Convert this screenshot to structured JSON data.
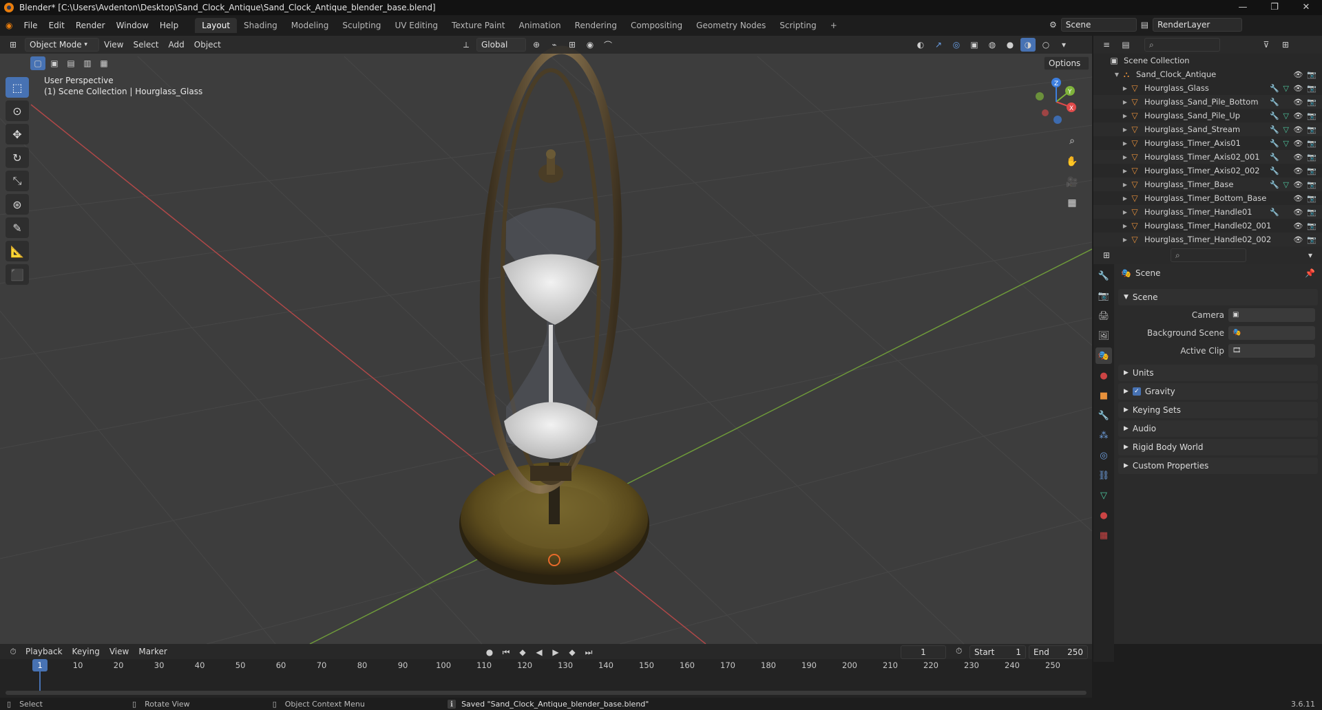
{
  "window": {
    "title": "Blender* [C:\\Users\\Avdenton\\Desktop\\Sand_Clock_Antique\\Sand_Clock_Antique_blender_base.blend]",
    "controls": [
      "—",
      "❐",
      "✕"
    ]
  },
  "menubar": {
    "menus": [
      "File",
      "Edit",
      "Render",
      "Window",
      "Help"
    ],
    "workspaces": [
      "Layout",
      "Shading",
      "Modeling",
      "Sculpting",
      "UV Editing",
      "Texture Paint",
      "Animation",
      "Rendering",
      "Compositing",
      "Geometry Nodes",
      "Scripting"
    ],
    "active_workspace": "Layout",
    "add_tab": "+",
    "scene_label": "Scene",
    "renderlayer_label": "RenderLayer"
  },
  "viewport_header": {
    "mode": "Object Mode",
    "menus": [
      "View",
      "Select",
      "Add",
      "Object"
    ],
    "transform_orientation": "Global",
    "options_label": "Options"
  },
  "viewport": {
    "perspective_label": "User Perspective",
    "collection_label": "(1) Scene Collection | Hourglass_Glass",
    "gizmo_axes": [
      "X",
      "Y",
      "Z"
    ],
    "colors": {
      "x_axis": "#e04a4a",
      "y_axis": "#7fb33b",
      "z_axis": "#3d7fe0",
      "background": "#3d3d3d",
      "grid": "#454545"
    }
  },
  "toolbar": {
    "tools": [
      "select-box-icon",
      "cursor-icon",
      "move-icon",
      "rotate-icon",
      "scale-icon",
      "transform-icon",
      "annotate-icon",
      "measure-icon",
      "add-cube-icon"
    ],
    "active_tool": "select-box-icon"
  },
  "outliner": {
    "root": "Scene Collection",
    "collection": "Sand_Clock_Antique",
    "objects": [
      {
        "name": "Hourglass_Glass",
        "mod": true,
        "geo": true
      },
      {
        "name": "Hourglass_Sand_Pile_Bottom",
        "mod": true,
        "geo": false
      },
      {
        "name": "Hourglass_Sand_Pile_Up",
        "mod": true,
        "geo": true
      },
      {
        "name": "Hourglass_Sand_Stream",
        "mod": true,
        "geo": true
      },
      {
        "name": "Hourglass_Timer_Axis01",
        "mod": true,
        "geo": true
      },
      {
        "name": "Hourglass_Timer_Axis02_001",
        "mod": true,
        "geo": false
      },
      {
        "name": "Hourglass_Timer_Axis02_002",
        "mod": true,
        "geo": false
      },
      {
        "name": "Hourglass_Timer_Base",
        "mod": true,
        "geo": true
      },
      {
        "name": "Hourglass_Timer_Bottom_Base",
        "mod": false,
        "geo": false
      },
      {
        "name": "Hourglass_Timer_Handle01",
        "mod": true,
        "geo": false
      },
      {
        "name": "Hourglass_Timer_Handle02_001",
        "mod": false,
        "geo": false
      },
      {
        "name": "Hourglass_Timer_Handle02_002",
        "mod": false,
        "geo": false
      }
    ]
  },
  "properties": {
    "context_label": "Scene",
    "scene_panel": "Scene",
    "fields": [
      {
        "label": "Camera"
      },
      {
        "label": "Background Scene"
      },
      {
        "label": "Active Clip"
      }
    ],
    "panels": [
      "Units",
      "Gravity",
      "Keying Sets",
      "Audio",
      "Rigid Body World",
      "Custom Properties"
    ],
    "gravity_checked": true
  },
  "timeline": {
    "menus": [
      "Playback",
      "Keying",
      "View",
      "Marker"
    ],
    "current_frame": "1",
    "start_label": "Start",
    "start_value": "1",
    "end_label": "End",
    "end_value": "250",
    "ticks": [
      "1",
      "10",
      "20",
      "30",
      "40",
      "50",
      "60",
      "70",
      "80",
      "90",
      "100",
      "110",
      "120",
      "130",
      "140",
      "150",
      "160",
      "170",
      "180",
      "190",
      "200",
      "210",
      "220",
      "230",
      "240",
      "250"
    ]
  },
  "statusbar": {
    "select": "Select",
    "rotate_view": "Rotate View",
    "context_menu": "Object Context Menu",
    "message": "Saved \"Sand_Clock_Antique_blender_base.blend\"",
    "version": "3.6.11"
  }
}
